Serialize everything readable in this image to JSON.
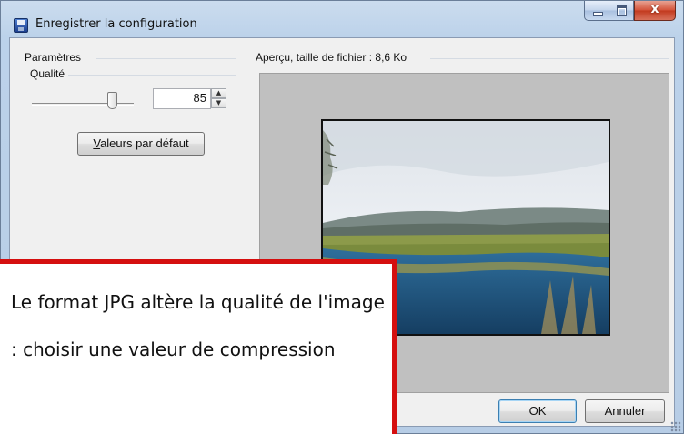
{
  "window": {
    "title": "Enregistrer la configuration",
    "controls": {
      "minimize_icon": "minimize-icon",
      "maximize_icon": "maximize-icon",
      "close_icon": "close-icon",
      "close_glyph": "x"
    }
  },
  "settings": {
    "group_label": "Paramètres",
    "quality_label": "Qualité",
    "quality_value": "85",
    "quality_level_percent": 85,
    "defaults_button": "Valeurs par défaut"
  },
  "preview": {
    "label": "Aperçu, taille de fichier : 8,6 Ko",
    "image_desc": "landscape-photo"
  },
  "buttons": {
    "ok": "OK",
    "cancel": "Annuler"
  },
  "annotation": {
    "text": "Le format JPG altère la qualité de l'image : choisir une valeur de compression",
    "border_color": "#d50f0f"
  }
}
